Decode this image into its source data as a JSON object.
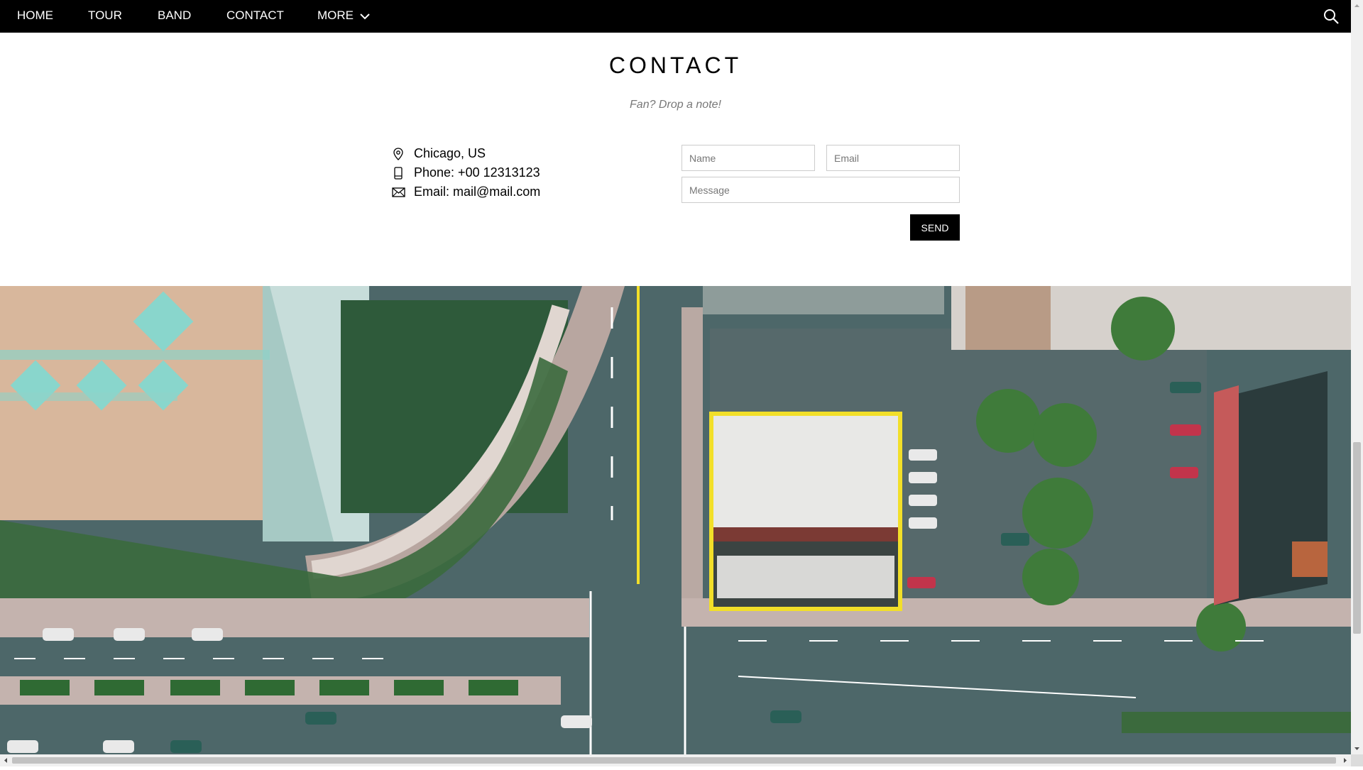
{
  "nav": {
    "items": [
      {
        "label": "HOME"
      },
      {
        "label": "TOUR"
      },
      {
        "label": "BAND"
      },
      {
        "label": "CONTACT"
      },
      {
        "label": "MORE"
      }
    ],
    "icons": {
      "more": "chevron-down-icon",
      "search": "search-icon"
    }
  },
  "contact": {
    "title": "CONTACT",
    "subtitle": "Fan? Drop a note!",
    "location": "Chicago, US",
    "phone": "Phone: +00 12313123",
    "email": "Email: mail@mail.com",
    "icons": {
      "location": "map-pin-icon",
      "phone": "phone-icon",
      "email": "envelope-icon"
    }
  },
  "form": {
    "name_placeholder": "Name",
    "email_placeholder": "Email",
    "message_placeholder": "Message",
    "send_label": "SEND"
  },
  "colors": {
    "nav_bg": "#000000",
    "button_bg": "#000000",
    "highlight": "#f2df29",
    "road": "#4a6466"
  }
}
